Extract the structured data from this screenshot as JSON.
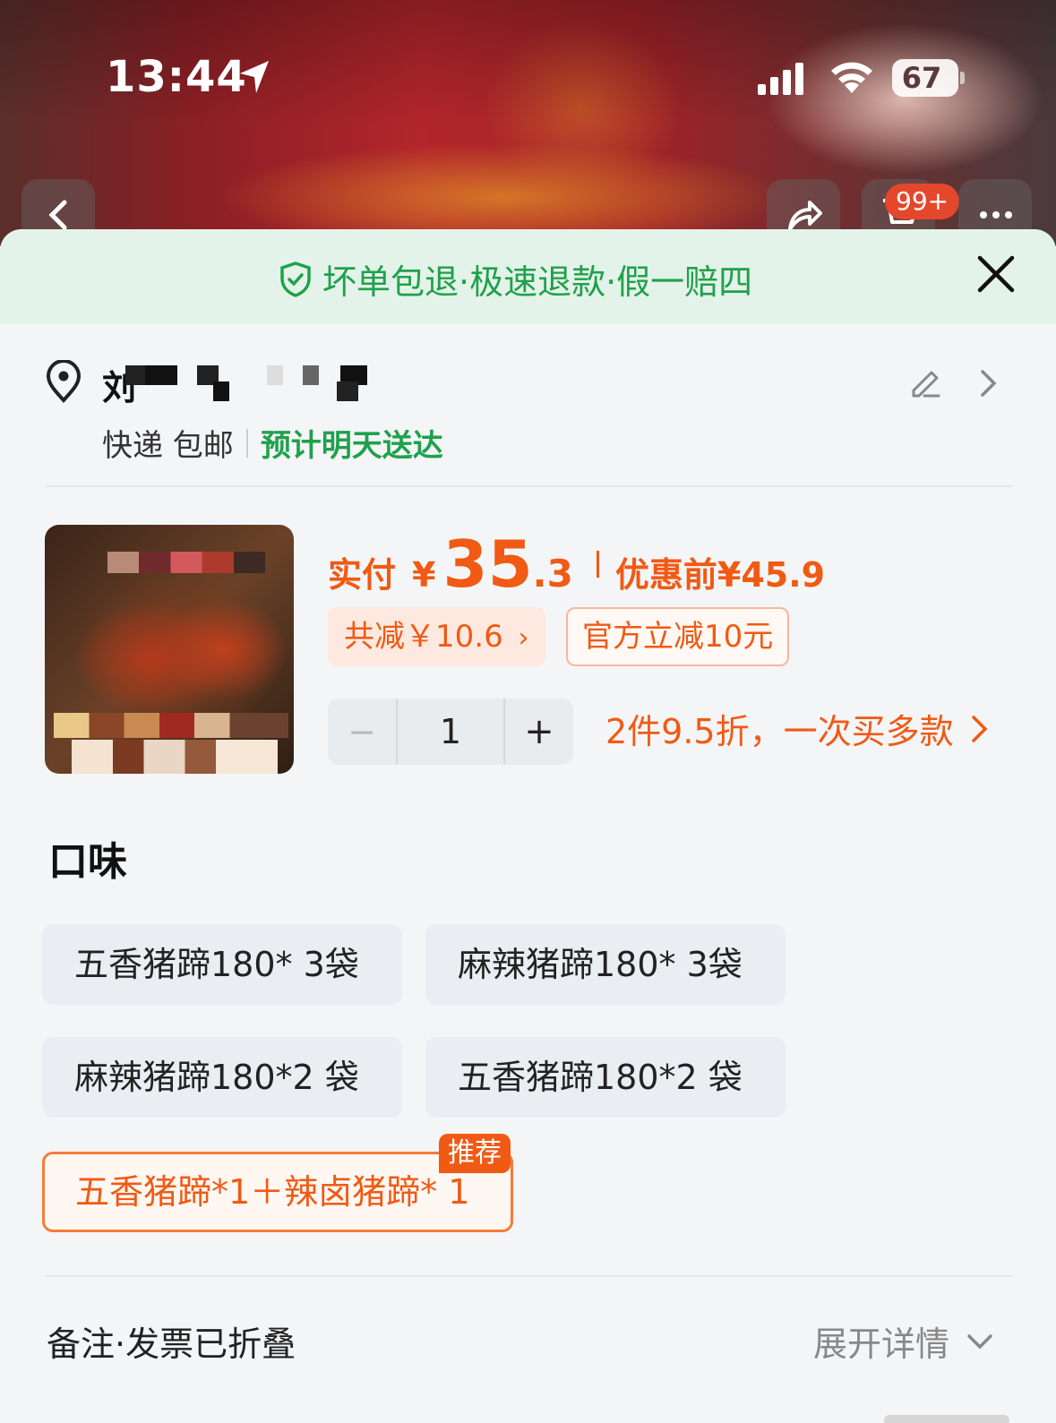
{
  "status_bar": {
    "time": "13:44",
    "battery": "67"
  },
  "top_nav": {
    "cart_badge": "99+"
  },
  "guarantee": {
    "text": "坏单包退·极速退款·假一赔四"
  },
  "address": {
    "name_visible": "刘",
    "shipping_method": "快递 包邮",
    "eta": "预计明天送达"
  },
  "product": {
    "price_label": "实付",
    "currency": "¥",
    "price_int": "35",
    "price_dec": ".3",
    "original_label": "优惠前",
    "original_price": "¥45.9",
    "total_discount": "共减￥10.6",
    "official_discount": "官方立减10元",
    "quantity": "1",
    "minus": "−",
    "plus": "+",
    "multi_deal": "2件9.5折，一次买多款"
  },
  "flavor": {
    "title": "口味",
    "options": [
      "五香猪蹄180* 3袋",
      "麻辣猪蹄180* 3袋",
      "麻辣猪蹄180*2 袋",
      "五香猪蹄180*2 袋",
      "五香猪蹄*1＋辣卤猪蹄* 1"
    ],
    "recommended_badge": "推荐",
    "selected_index": 4
  },
  "notes": {
    "label": "备注·发票已折叠",
    "expand": "展开详情"
  },
  "colors": {
    "accent_orange": "#f05a14",
    "green": "#1fa14b"
  }
}
